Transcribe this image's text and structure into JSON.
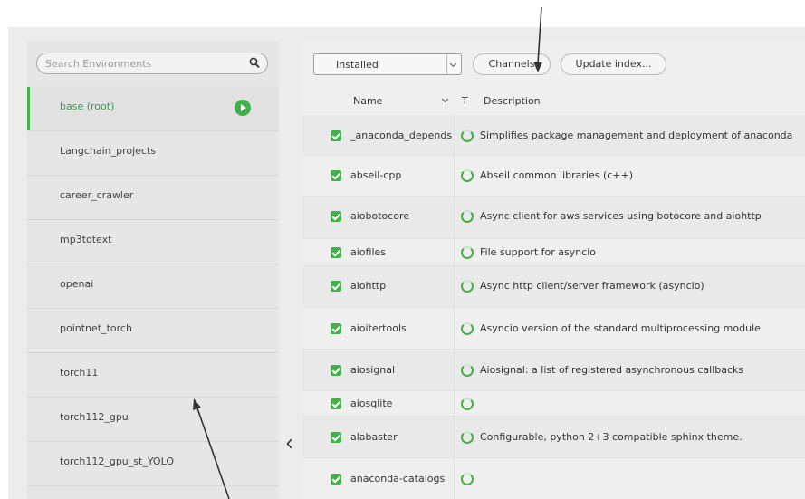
{
  "search": {
    "placeholder": "Search Environments"
  },
  "environments": [
    {
      "name": "base (root)",
      "active": true
    },
    {
      "name": "Langchain_projects"
    },
    {
      "name": "career_crawler"
    },
    {
      "name": "mp3totext"
    },
    {
      "name": "openai"
    },
    {
      "name": "pointnet_torch"
    },
    {
      "name": "torch11"
    },
    {
      "name": "torch112_gpu"
    },
    {
      "name": "torch112_gpu_st_YOLO"
    }
  ],
  "toolbar": {
    "filter_value": "Installed",
    "channels_label": "Channels",
    "update_label": "Update index..."
  },
  "table": {
    "headers": {
      "name": "Name",
      "type": "T",
      "description": "Description"
    }
  },
  "packages": [
    {
      "name": "_anaconda_depends",
      "description": "Simplifies package management and deployment of anaconda",
      "checked": true
    },
    {
      "name": "abseil-cpp",
      "description": "Abseil common libraries (c++)",
      "checked": true
    },
    {
      "name": "aiobotocore",
      "description": "Async client for aws services using botocore and aiohttp",
      "checked": true
    },
    {
      "name": "aiofiles",
      "description": "File support for asyncio",
      "checked": true
    },
    {
      "name": "aiohttp",
      "description": "Async http client/server framework (asyncio)",
      "checked": true
    },
    {
      "name": "aioitertools",
      "description": "Asyncio version of the standard multiprocessing module",
      "checked": true
    },
    {
      "name": "aiosignal",
      "description": "Aiosignal: a list of registered asynchronous callbacks",
      "checked": true
    },
    {
      "name": "aiosqlite",
      "description": "",
      "checked": true
    },
    {
      "name": "alabaster",
      "description": "Configurable, python 2+3 compatible sphinx theme.",
      "checked": true
    },
    {
      "name": "anaconda-catalogs",
      "description": "",
      "checked": true
    }
  ],
  "colors": {
    "accent": "#43b049",
    "active_text": "#3f9a4a"
  }
}
